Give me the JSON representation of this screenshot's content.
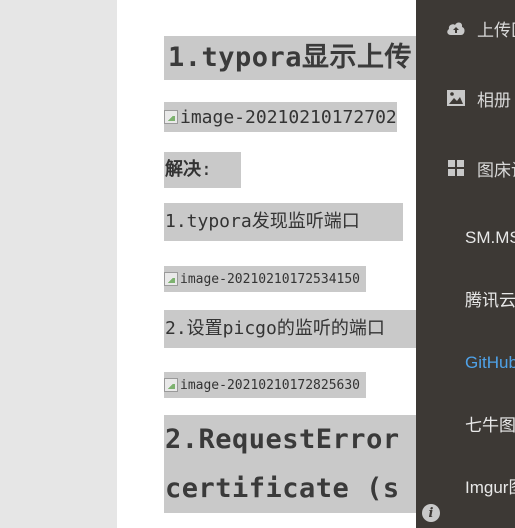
{
  "document": {
    "heading1": "1.typora显示上传",
    "image1_alt": "image-20210210172702",
    "solution_label": "解决",
    "solution_colon": ":",
    "step1": "1.typora发现监听端口",
    "image2_alt": "image-20210210172534150",
    "step2": "2.设置picgo的监听的端口",
    "image3_alt": "image-20210210172825630",
    "heading2_line1": "2.RequestError",
    "heading2_line2": "certificate (s"
  },
  "sidebar": {
    "items": [
      {
        "label": "上传区",
        "icon": "cloud-upload-icon"
      },
      {
        "label": "相册",
        "icon": "image-icon"
      },
      {
        "label": "图床设置",
        "icon": "grid-icon"
      }
    ],
    "submenu": [
      {
        "label": "SM.MS图床",
        "active": false
      },
      {
        "label": "腾讯云COS",
        "active": false
      },
      {
        "label": "GitHub图床",
        "active": true
      },
      {
        "label": "七牛图床",
        "active": false
      },
      {
        "label": "Imgur图床",
        "active": false
      }
    ],
    "info_symbol": "i"
  },
  "colors": {
    "sidebar_bg": "#3d3935",
    "active_link": "#4fa2e8",
    "highlight": "#c9c9c9"
  }
}
